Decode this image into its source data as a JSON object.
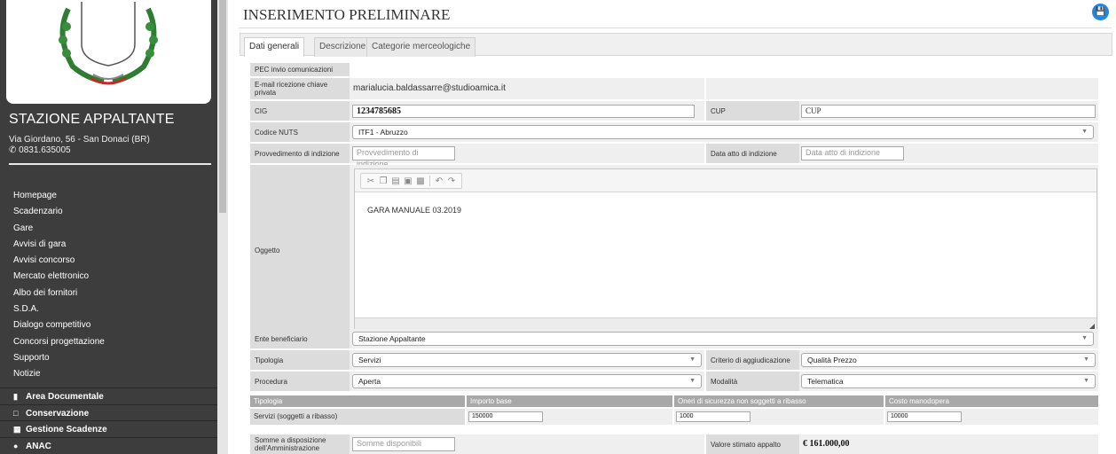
{
  "sidebar": {
    "title": "STAZIONE APPALTANTE",
    "address": "Via Giordano, 56 - San Donaci (BR)",
    "phone": "0831.635005",
    "menu": [
      "Homepage",
      "Scadenzario",
      "Gare",
      "Avvisi di gara",
      "Avvisi concorso",
      "Mercato elettronico",
      "Albo dei fornitori",
      "S.D.A.",
      "Dialogo competitivo",
      "Concorsi progettazione",
      "Supporto",
      "Notizie"
    ],
    "sections": [
      {
        "label": "Area Documentale",
        "icon": "book-icon"
      },
      {
        "label": "Conservazione",
        "icon": "file-icon"
      },
      {
        "label": "Gestione Scadenze",
        "icon": "calendar-icon"
      },
      {
        "label": "ANAC",
        "icon": "circle-icon"
      }
    ]
  },
  "header": {
    "title": "INSERIMENTO PRELIMINARE"
  },
  "tabs": [
    "Dati generali",
    "Descrizione",
    "Categorie merceologiche"
  ],
  "form": {
    "pec_label": "PEC invio comunicazioni",
    "email_label": "E-mail ricezione chiave privata",
    "email_value": "marialucia.baldassarre@studioamica.it",
    "cig_label": "CIG",
    "cig_value": "1234785685",
    "cup_label": "CUP",
    "cup_value": "CUP",
    "nuts_label": "Codice NUTS",
    "nuts_value": "ITF1 - Abruzzo",
    "provv_label": "Provvedimento di indizione",
    "provv_placeholder": "Provvedimento di indizione",
    "data_atto_label": "Data atto di indizione",
    "data_atto_placeholder": "Data atto di indizione",
    "oggetto_label": "Oggetto",
    "oggetto_value": "GARA MANUALE 03.2019",
    "ente_label": "Ente beneficiario",
    "ente_value": "Stazione Appaltante",
    "tipologia_label": "Tipologia",
    "tipologia_value": "Servizi",
    "criterio_label": "Criterio di aggiudicazione",
    "criterio_value": "Qualità Prezzo",
    "procedura_label": "Procedura",
    "procedura_value": "Aperta",
    "modalita_label": "Modalità",
    "modalita_value": "Telematica",
    "somme_label": "Somme a disposizione dell'Amministrazione",
    "somme_placeholder": "Somme disponibili",
    "valore_label": "Valore stimato appalto",
    "valore_value": "€ 161.000,00"
  },
  "table": {
    "headers": [
      "Tipologia",
      "Importo base",
      "Oneri di sicurezza non soggetti a ribasso",
      "Costo manodopera"
    ],
    "row": {
      "tipologia": "Servizi (soggetti a ribasso)",
      "importo": "150000",
      "oneri": "1000",
      "costo": "10000"
    }
  }
}
